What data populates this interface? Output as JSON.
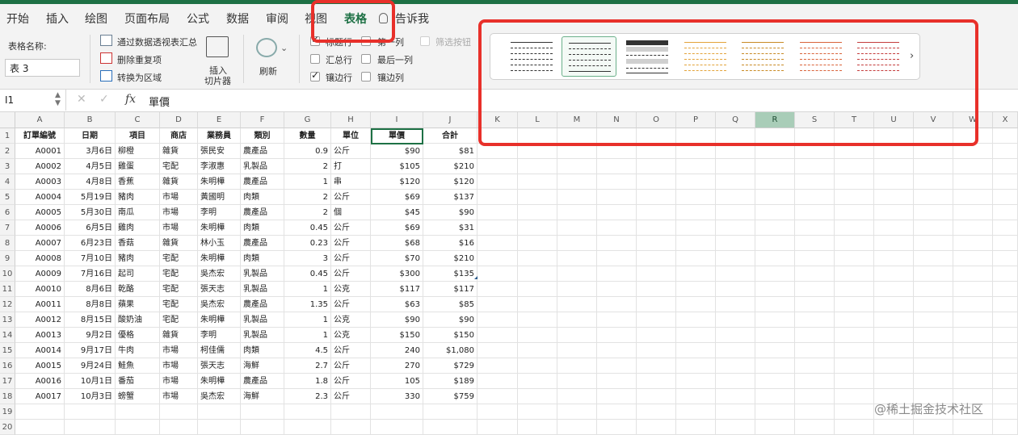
{
  "colors": {
    "accent": "#1e7145",
    "highlight_box": "#e8302a",
    "selected_col": "#a9cdb8"
  },
  "tabs": [
    "开始",
    "插入",
    "绘图",
    "页面布局",
    "公式",
    "数据",
    "审阅",
    "视图",
    "表格",
    "告诉我"
  ],
  "active_tab": "表格",
  "ribbon": {
    "table_name_label": "表格名称:",
    "table_name_value": "表 3",
    "tools": [
      "通过数据透视表汇总",
      "删除重复项",
      "转换为区域"
    ],
    "slicer_label_1": "插入",
    "slicer_label_2": "切片器",
    "refresh_label": "刷新",
    "options": {
      "header_row": "标题行",
      "first_col": "第一列",
      "filter_button": "筛选按钮",
      "total_row": "汇总行",
      "last_col": "最后一列",
      "banded_rows": "镶边行",
      "banded_cols": "镶边列"
    },
    "option_states": {
      "header_row": true,
      "first_col": false,
      "filter_button": false,
      "total_row": false,
      "last_col": false,
      "banded_rows": true,
      "banded_cols": false
    },
    "gallery_more": "›"
  },
  "formula_bar": {
    "cell_ref": "I1",
    "fx": "fx",
    "value": "單價"
  },
  "columns": [
    "A",
    "B",
    "C",
    "D",
    "E",
    "F",
    "G",
    "H",
    "I",
    "J",
    "K",
    "L",
    "M",
    "N",
    "O",
    "P",
    "Q",
    "R",
    "S",
    "T",
    "U",
    "V",
    "W",
    "X"
  ],
  "selected_column": "R",
  "row_numbers": [
    "1",
    "2",
    "3",
    "4",
    "5",
    "6",
    "7",
    "8",
    "9",
    "10",
    "11",
    "12",
    "13",
    "14",
    "15",
    "16",
    "17",
    "18",
    "19",
    "20"
  ],
  "table": {
    "headers": [
      "訂單編號",
      "日期",
      "項目",
      "商店",
      "業務員",
      "類別",
      "數量",
      "單位",
      "單價",
      "合計"
    ],
    "rows": [
      [
        "A0001",
        "3月6日",
        "柳橙",
        "雜貨",
        "張民安",
        "農產品",
        "0.9",
        "公斤",
        "$90",
        "$81"
      ],
      [
        "A0002",
        "4月5日",
        "雞蛋",
        "宅配",
        "李淑惠",
        "乳製品",
        "2",
        "打",
        "$105",
        "$210"
      ],
      [
        "A0003",
        "4月8日",
        "香蕉",
        "雜貨",
        "朱明樺",
        "農產品",
        "1",
        "串",
        "$120",
        "$120"
      ],
      [
        "A0004",
        "5月19日",
        "豬肉",
        "市場",
        "黃國明",
        "肉類",
        "2",
        "公斤",
        "$69",
        "$137"
      ],
      [
        "A0005",
        "5月30日",
        "南瓜",
        "市場",
        "李明",
        "農產品",
        "2",
        "個",
        "$45",
        "$90"
      ],
      [
        "A0006",
        "6月5日",
        "雞肉",
        "市場",
        "朱明樺",
        "肉類",
        "0.45",
        "公斤",
        "$69",
        "$31"
      ],
      [
        "A0007",
        "6月23日",
        "香菇",
        "雜貨",
        "林小玉",
        "農產品",
        "0.23",
        "公斤",
        "$68",
        "$16"
      ],
      [
        "A0008",
        "7月10日",
        "豬肉",
        "宅配",
        "朱明樺",
        "肉類",
        "3",
        "公斤",
        "$70",
        "$210"
      ],
      [
        "A0009",
        "7月16日",
        "起司",
        "宅配",
        "吳杰宏",
        "乳製品",
        "0.45",
        "公斤",
        "$300",
        "$135"
      ],
      [
        "A0010",
        "8月6日",
        "乾酪",
        "宅配",
        "張天志",
        "乳製品",
        "1",
        "公克",
        "$117",
        "$117"
      ],
      [
        "A0011",
        "8月8日",
        "蘋果",
        "宅配",
        "吳杰宏",
        "農產品",
        "1.35",
        "公斤",
        "$63",
        "$85"
      ],
      [
        "A0012",
        "8月15日",
        "酸奶油",
        "宅配",
        "朱明樺",
        "乳製品",
        "1",
        "公克",
        "$90",
        "$90"
      ],
      [
        "A0013",
        "9月2日",
        "優格",
        "雜貨",
        "李明",
        "乳製品",
        "1",
        "公克",
        "$150",
        "$150"
      ],
      [
        "A0014",
        "9月17日",
        "牛肉",
        "市場",
        "柯佳儒",
        "肉類",
        "4.5",
        "公斤",
        "240",
        "$1,080"
      ],
      [
        "A0015",
        "9月24日",
        "鮭魚",
        "市場",
        "張天志",
        "海鮮",
        "2.7",
        "公斤",
        "270",
        "$729"
      ],
      [
        "A0016",
        "10月1日",
        "番茄",
        "市場",
        "朱明樺",
        "農產品",
        "1.8",
        "公斤",
        "105",
        "$189"
      ],
      [
        "A0017",
        "10月3日",
        "螃蟹",
        "市場",
        "吳杰宏",
        "海鮮",
        "2.3",
        "公斤",
        "330",
        "$759"
      ]
    ]
  },
  "watermark": "@稀土掘金技术社区"
}
